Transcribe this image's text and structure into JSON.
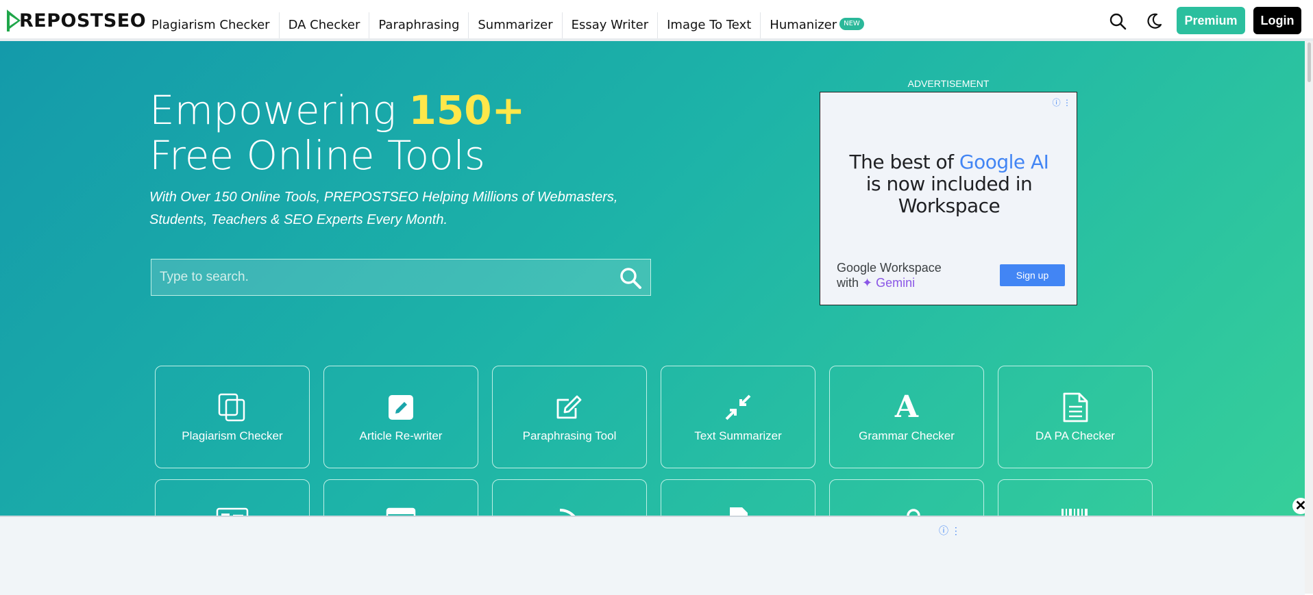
{
  "header": {
    "logo_text": "REPOSTSEO",
    "nav": [
      {
        "label": "Plagiarism Checker"
      },
      {
        "label": "DA Checker"
      },
      {
        "label": "Paraphrasing"
      },
      {
        "label": "Summarizer"
      },
      {
        "label": "Essay Writer"
      },
      {
        "label": "Image To Text"
      },
      {
        "label": "Humanizer",
        "badge": "NEW"
      }
    ],
    "premium_label": "Premium",
    "login_label": "Login"
  },
  "hero": {
    "title_line1_prefix": "Empowering ",
    "title_line1_accent": "150+",
    "title_line2": "Free Online Tools",
    "subtitle": "With Over 150 Online Tools, PREPOSTSEO Helping Millions of Webmasters, Students, Teachers & SEO Experts Every Month.",
    "search_placeholder": "Type to search."
  },
  "ad": {
    "label": "ADVERTISEMENT",
    "headline_prefix": "The best of ",
    "headline_google": "Google AI",
    "headline_rest": "is now included in Workspace",
    "footer_line1": "Google Workspace",
    "footer_line2_prefix": "with ",
    "footer_line2_brand": "✦ Gemini",
    "signup": "Sign up"
  },
  "tools": [
    {
      "label": "Plagiarism Checker",
      "icon": "copy-icon"
    },
    {
      "label": "Article Re-writer",
      "icon": "edit-square-icon"
    },
    {
      "label": "Paraphrasing Tool",
      "icon": "pen-square-icon"
    },
    {
      "label": "Text Summarizer",
      "icon": "compress-icon"
    },
    {
      "label": "Grammar Checker",
      "icon": "font-a-icon"
    },
    {
      "label": "DA PA Checker",
      "icon": "document-icon"
    }
  ],
  "colors": {
    "accent": "#ffe74a",
    "premium": "#2bbf9e",
    "brand_green": "#2bb89a"
  }
}
